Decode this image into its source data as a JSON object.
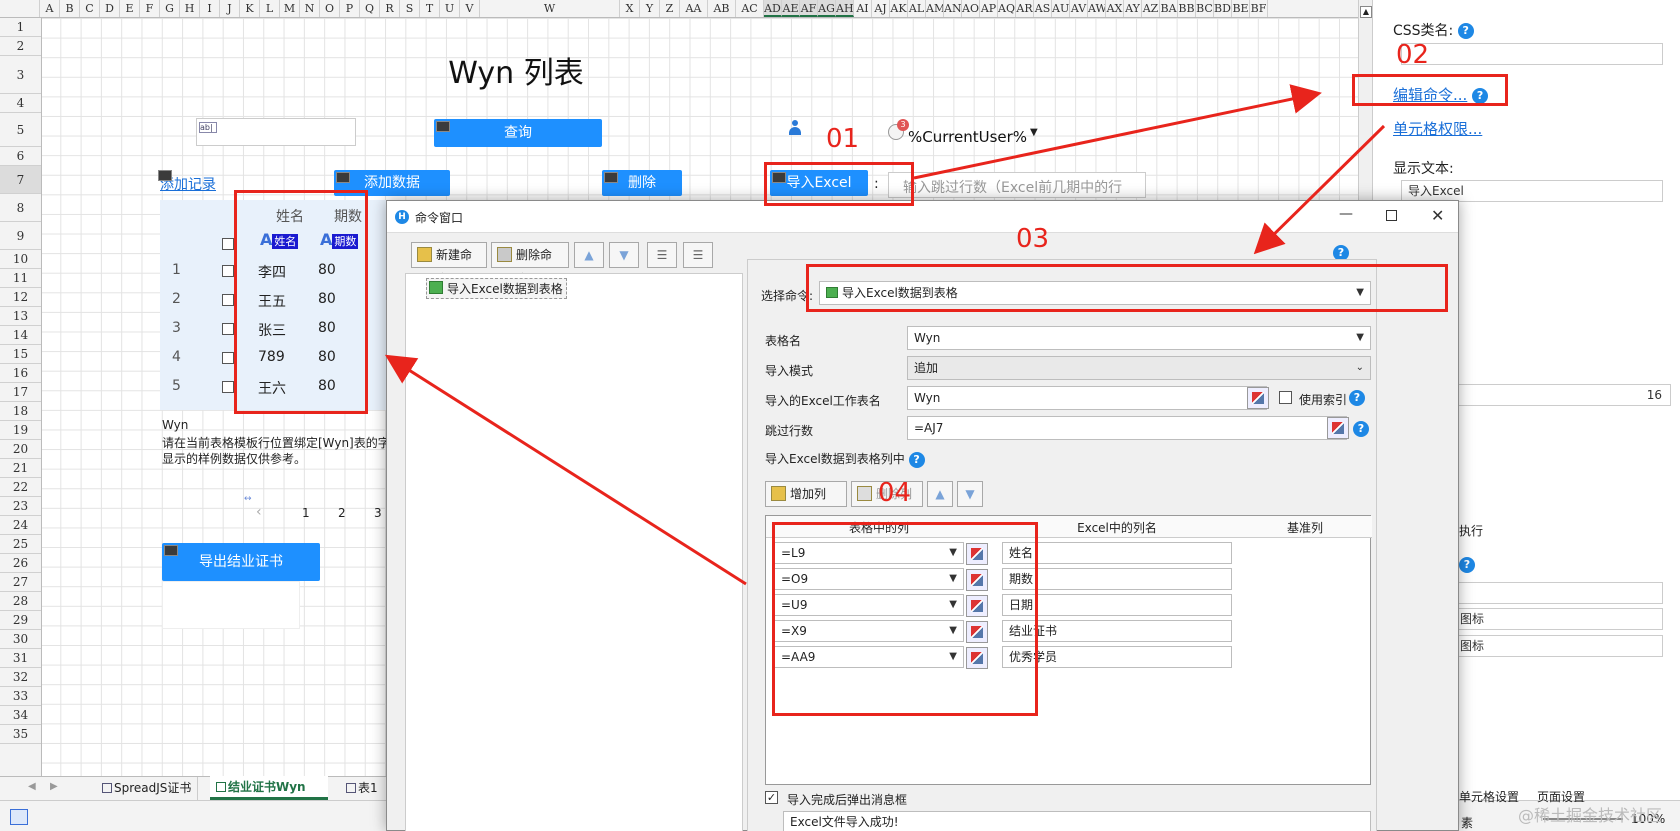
{
  "sheet": {
    "columns": [
      "A",
      "B",
      "C",
      "D",
      "E",
      "F",
      "G",
      "H",
      "I",
      "J",
      "K",
      "L",
      "M",
      "N",
      "O",
      "P",
      "Q",
      "R",
      "S",
      "T",
      "U",
      "V",
      "W",
      "X",
      "Y",
      "Z",
      "AA",
      "AB",
      "AC",
      "AD",
      "AE",
      "AF",
      "AG",
      "AH",
      "AI",
      "AJ",
      "AK",
      "AL",
      "AM",
      "AN",
      "AO",
      "AP",
      "AQ",
      "AR",
      "AS",
      "AU",
      "AV",
      "AW",
      "AX",
      "AY",
      "AZ",
      "BA",
      "BB",
      "BC",
      "BD",
      "BE",
      "BF"
    ],
    "rows": [
      "1",
      "2",
      "3",
      "4",
      "5",
      "6",
      "7",
      "8",
      "9",
      "10",
      "11",
      "12",
      "13",
      "14",
      "15",
      "16",
      "17",
      "18",
      "19",
      "20",
      "21",
      "22",
      "23",
      "24",
      "25",
      "26",
      "27",
      "28",
      "29",
      "30",
      "31",
      "32",
      "33",
      "34",
      "35"
    ],
    "title": "Wyn 列表",
    "query_button": "查询",
    "user_placeholder": "%CurrentUser%",
    "add_record_link": "添加记录",
    "add_data_button": "添加数据",
    "delete_button": "删除",
    "import_excel_button": "导入Excel",
    "colon": ":",
    "skip_rows_placeholder": "输入跳过行数（Excel前几期中的行",
    "table_headers": {
      "name": "姓名",
      "period": "期数"
    },
    "badges": {
      "name": "姓名",
      "period": "期数"
    },
    "table_rows": [
      {
        "idx": "1",
        "name": "李四",
        "period": "80"
      },
      {
        "idx": "2",
        "name": "王五",
        "period": "80"
      },
      {
        "idx": "3",
        "name": "张三",
        "period": "80"
      },
      {
        "idx": "4",
        "name": "789",
        "period": "80"
      },
      {
        "idx": "5",
        "name": "王六",
        "period": "80"
      }
    ],
    "note_title": "Wyn",
    "note_line1": "请在当前表格模板行位置绑定[Wyn]表的字",
    "note_line2": "显示的样例数据仅供参考。",
    "pager": [
      "1",
      "2",
      "3"
    ],
    "export_button": "导出结业证书"
  },
  "tabs": [
    "SpreadJS证书",
    "结业证书Wyn",
    "表1"
  ],
  "right_panel": {
    "css_label": "CSS类名:",
    "edit_command": "编辑命令...",
    "cell_permission": "单元格权限...",
    "display_text_label": "显示文本:",
    "display_text_value": "导入Excel",
    "number_value": "16",
    "exec_text": "执行",
    "icon_text_1": "图标",
    "icon_text_2": "图标",
    "bottom_tab_1": "单元格设置",
    "bottom_tab_2": "页面设置",
    "bottom_text": "素",
    "zoom": "100%",
    "watermark": "@稀土掘金技术社区"
  },
  "dialog": {
    "title": "命令窗口",
    "new_cmd": "新建命令",
    "delete_cmd": "删除命令",
    "tree_item": "导入Excel数据到表格",
    "select_cmd_label": "选择命令:",
    "select_cmd_value": "导入Excel数据到表格",
    "table_name_label": "表格名",
    "table_name_value": "Wyn",
    "mode_label": "导入模式",
    "mode_value": "追加",
    "sheet_name_label": "导入的Excel工作表名",
    "sheet_name_value": "Wyn",
    "use_index_label": "使用索引",
    "skip_label": "跳过行数",
    "skip_value": "=AJ7",
    "map_label": "导入Excel数据到表格列中",
    "add_col": "增加列",
    "del_col": "删除列",
    "grid_headers": [
      "表格中的列",
      "Excel中的列名",
      "基准列"
    ],
    "grid_rows": [
      {
        "col": "=L9",
        "excel": "姓名"
      },
      {
        "col": "=O9",
        "excel": "期数"
      },
      {
        "col": "=U9",
        "excel": "日期"
      },
      {
        "col": "=X9",
        "excel": "结业证书"
      },
      {
        "col": "=AA9",
        "excel": "优秀学员"
      }
    ],
    "popup_label": "导入完成后弹出消息框",
    "popup_message": "Excel文件导入成功!"
  },
  "annotations": {
    "a01": "01",
    "a02": "02",
    "a03": "03",
    "a04": "04"
  },
  "colors": {
    "accent": "#1e90ff",
    "annotation": "#e8241c",
    "link": "#1a6fd8"
  }
}
